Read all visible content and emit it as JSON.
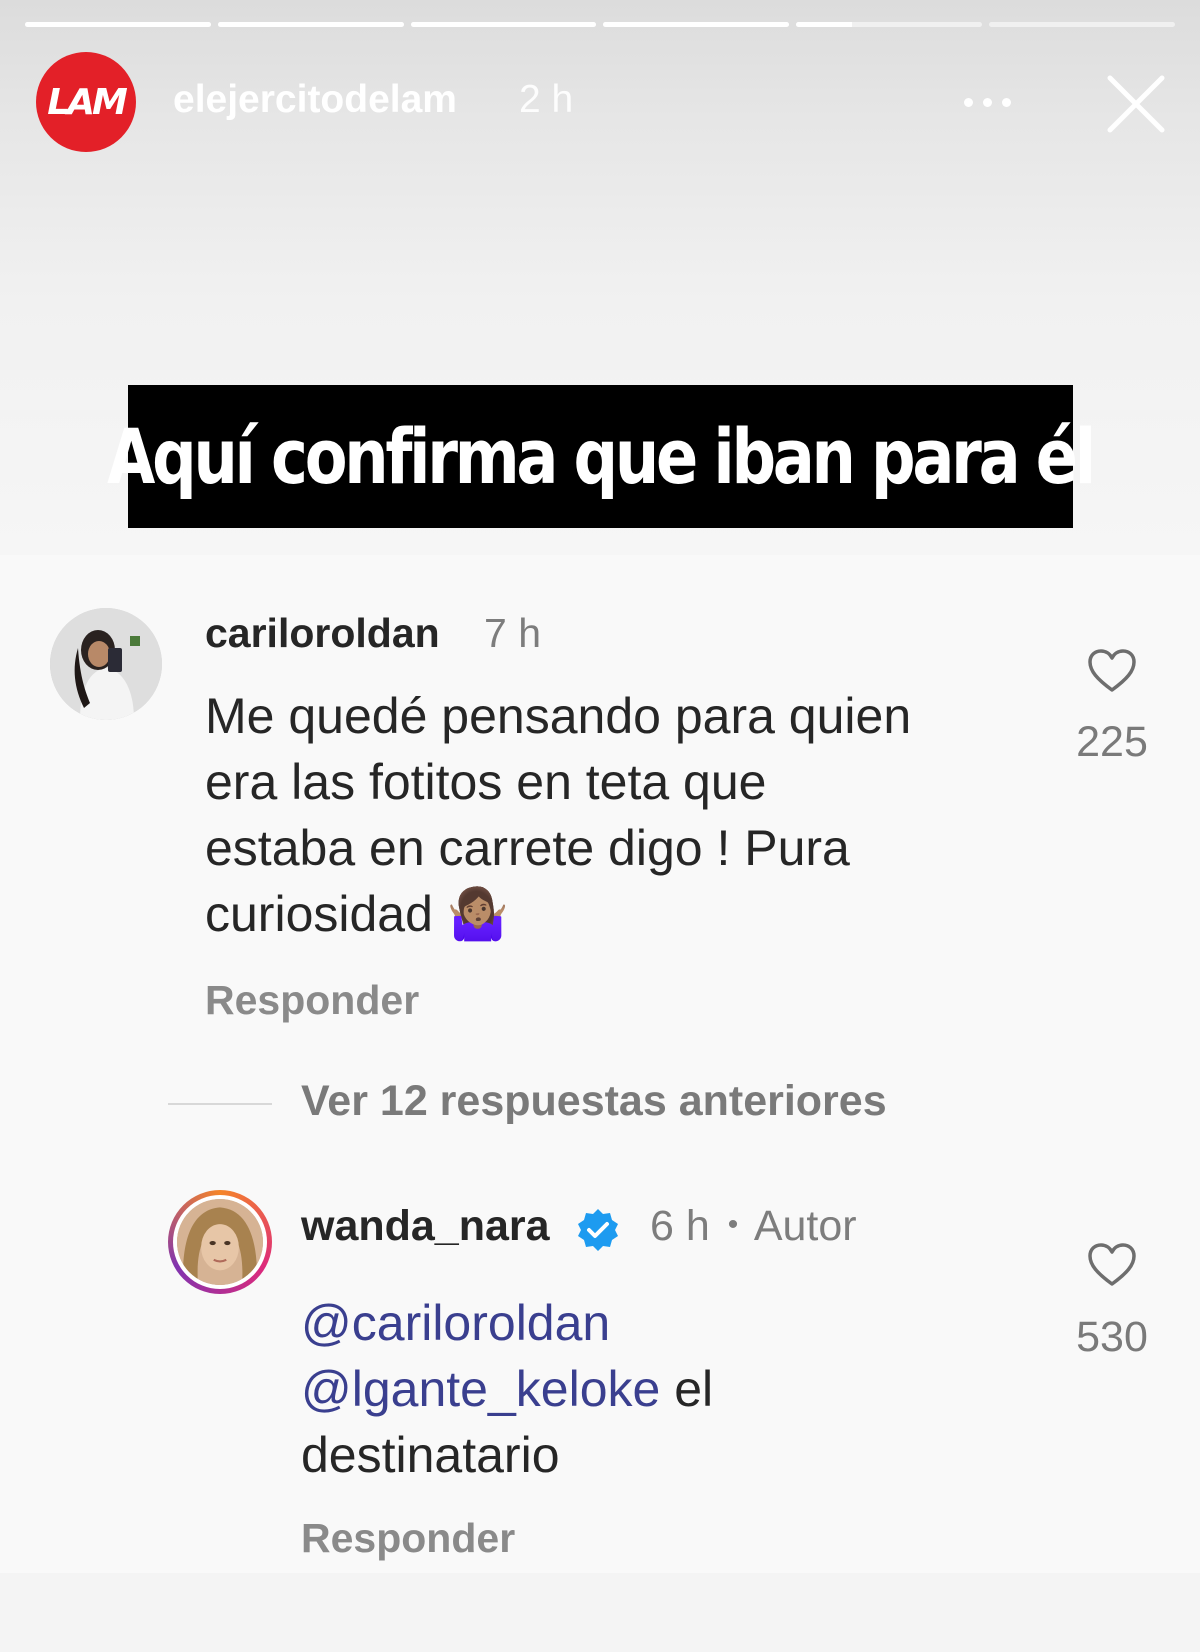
{
  "story": {
    "account": "elejercitodelam",
    "time": "2 h",
    "logo_text": "LAM",
    "progress_segments": [
      1,
      1,
      1,
      1,
      0.3,
      0
    ],
    "banner_text": "Aquí confirma que iban para él"
  },
  "comments": [
    {
      "username": "cariloroldan",
      "time": "7 h",
      "text": "Me quedé pensando para quien era las fotitos en teta que estaba en carrete digo ! Pura curiosidad 🤷🏽‍♀️",
      "lines": [
        "Me quedé pensando para quien",
        "era las fotitos en teta que",
        "estaba en carrete digo ! Pura",
        "curiosidad 🤷🏽‍♀️"
      ],
      "likes": "225",
      "reply_label": "Responder"
    }
  ],
  "view_replies_label": "Ver 12 respuestas anteriores",
  "reply": {
    "username": "wanda_nara",
    "verified": true,
    "time": "6 h",
    "separator": "•",
    "author_label": "Autor",
    "mention1": "@cariloroldan",
    "mention2": "@lgante_keloke",
    "text_after_mention2": " el",
    "last_line": "destinatario",
    "likes": "530",
    "reply_label": "Responder"
  },
  "colors": {
    "logo_red": "#e32028",
    "mention_blue": "#3a3f8f",
    "verified_blue": "#1d9bf0"
  }
}
